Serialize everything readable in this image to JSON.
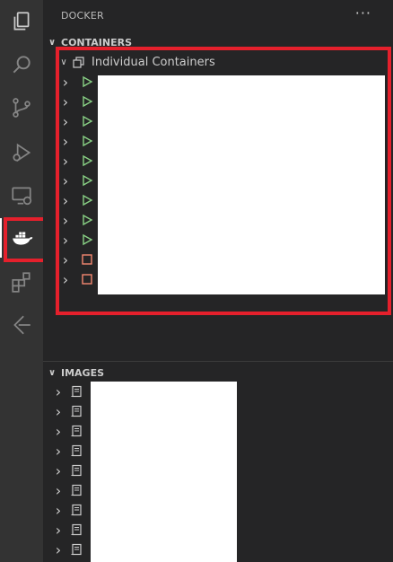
{
  "sidebar": {
    "title": "DOCKER",
    "more_label": "···"
  },
  "containers": {
    "header": "CONTAINERS",
    "group_label": "Individual Containers",
    "items": [
      {
        "status": "running"
      },
      {
        "status": "running"
      },
      {
        "status": "running"
      },
      {
        "status": "running"
      },
      {
        "status": "running"
      },
      {
        "status": "running"
      },
      {
        "status": "running"
      },
      {
        "status": "running"
      },
      {
        "status": "running"
      },
      {
        "status": "stopped"
      },
      {
        "status": "stopped"
      }
    ]
  },
  "images": {
    "header": "IMAGES",
    "count_visible": 9
  },
  "colors": {
    "running": "#89d185",
    "stopped": "#f48771",
    "highlight": "#e5202c"
  }
}
